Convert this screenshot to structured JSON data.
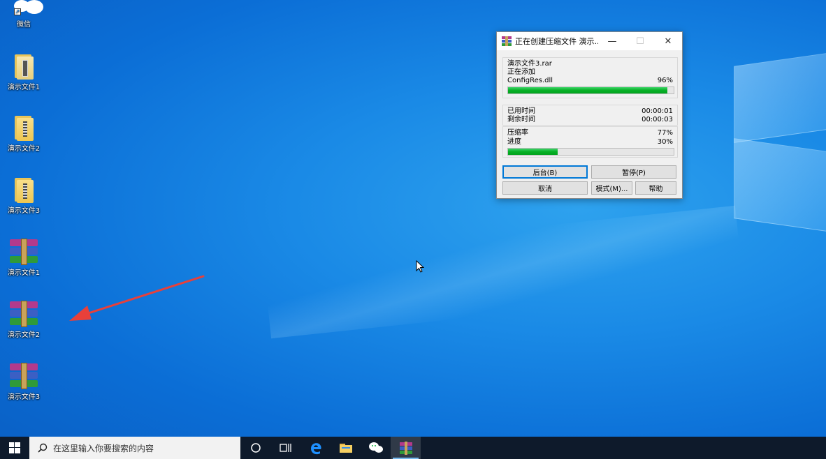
{
  "desktop": {
    "icons": [
      {
        "label": "微信",
        "kind": "wechat",
        "icon": "wechat-icon"
      },
      {
        "label": "演示文件1",
        "kind": "folder-zip",
        "icon": "zip-folder-icon"
      },
      {
        "label": "演示文件2",
        "kind": "folder",
        "icon": "folder-icon"
      },
      {
        "label": "演示文件3",
        "kind": "folder",
        "icon": "folder-icon"
      },
      {
        "label": "演示文件1",
        "kind": "rar",
        "icon": "winrar-archive-icon"
      },
      {
        "label": "演示文件2",
        "kind": "rar",
        "icon": "winrar-archive-icon"
      },
      {
        "label": "演示文件3",
        "kind": "rar",
        "icon": "winrar-archive-icon"
      }
    ],
    "annotation_color": "#e8403a"
  },
  "dialog": {
    "title": "正在创建压缩文件 演示...",
    "controls": {
      "minimize": "—",
      "maximize": "☐",
      "close": "✕"
    },
    "archive_name": "演示文件3.rar",
    "action": "正在添加",
    "current_file": "ConfigRes.dll",
    "file_percent": "96%",
    "file_progress": 0.96,
    "elapsed_label": "已用时间",
    "elapsed_value": "00:00:01",
    "remaining_label": "剩余时间",
    "remaining_value": "00:00:03",
    "ratio_label": "压缩率",
    "ratio_value": "77%",
    "progress_label": "进度",
    "progress_value": "30%",
    "total_progress": 0.3,
    "buttons": {
      "background": "后台(B)",
      "pause": "暂停(P)",
      "cancel": "取消",
      "mode": "模式(M)...",
      "help": "帮助"
    }
  },
  "taskbar": {
    "search_placeholder": "在这里输入你要搜索的内容",
    "items": [
      "cortana-icon",
      "task-view-icon",
      "edge-icon",
      "file-explorer-icon",
      "wechat-icon",
      "winrar-icon"
    ]
  },
  "colors": {
    "progress": "#06b025",
    "accent": "#0078d7",
    "taskbar": "#0e1a2b"
  }
}
